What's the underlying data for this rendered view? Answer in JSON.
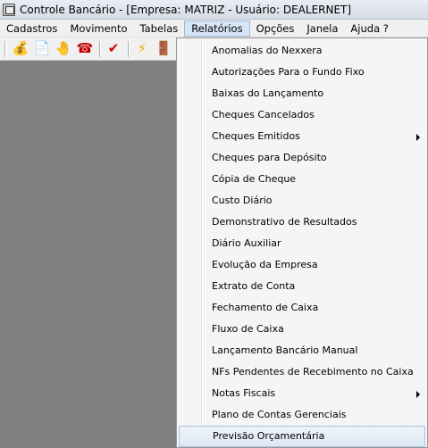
{
  "window": {
    "title": "Controle Bancário - [Empresa: MATRIZ - Usuário: DEALERNET]"
  },
  "menubar": {
    "items": [
      {
        "label": "Cadastros"
      },
      {
        "label": "Movimento"
      },
      {
        "label": "Tabelas"
      },
      {
        "label": "Relatórios"
      },
      {
        "label": "Opções"
      },
      {
        "label": "Janela"
      },
      {
        "label": "Ajuda ?"
      }
    ],
    "active": "Relatórios"
  },
  "toolbar": {
    "buttons": [
      {
        "icon": "money-bag-icon",
        "glyph": "💰"
      },
      {
        "icon": "document-icon",
        "glyph": "📄"
      },
      {
        "icon": "hand-icon",
        "glyph": "🤚"
      },
      {
        "icon": "phone-icon",
        "glyph": "☎"
      },
      {
        "icon": "checkmark-icon",
        "glyph": "✔"
      },
      {
        "icon": "lightning-icon",
        "glyph": "⚡"
      },
      {
        "icon": "exit-door-icon",
        "glyph": "🚪"
      }
    ]
  },
  "relatorios_menu": {
    "items": [
      {
        "label": "Anomalias do Nexxera",
        "submenu": false
      },
      {
        "label": "Autorizações Para o Fundo Fixo",
        "submenu": false
      },
      {
        "label": "Baixas do Lançamento",
        "submenu": false
      },
      {
        "label": "Cheques Cancelados",
        "submenu": false
      },
      {
        "label": "Cheques Emitidos",
        "submenu": true
      },
      {
        "label": "Cheques para Depósito",
        "submenu": false
      },
      {
        "label": "Cópia de Cheque",
        "submenu": false
      },
      {
        "label": "Custo Diário",
        "submenu": false
      },
      {
        "label": "Demonstrativo de Resultados",
        "submenu": false
      },
      {
        "label": "Diário Auxiliar",
        "submenu": false
      },
      {
        "label": "Evolução da Empresa",
        "submenu": false
      },
      {
        "label": "Extrato de Conta",
        "submenu": false
      },
      {
        "label": "Fechamento de Caixa",
        "submenu": false
      },
      {
        "label": "Fluxo de Caixa",
        "submenu": false
      },
      {
        "label": "Lançamento Bancário Manual",
        "submenu": false
      },
      {
        "label": "NFs Pendentes de Recebimento no Caixa",
        "submenu": false
      },
      {
        "label": "Notas Fiscais",
        "submenu": true
      },
      {
        "label": "Plano de Contas Gerenciais",
        "submenu": false
      },
      {
        "label": "Previsão Orçamentária",
        "submenu": false
      }
    ],
    "highlighted": "Previsão Orçamentária"
  },
  "colors": {
    "workspace": "#808080",
    "highlight": "#dde8f5",
    "menubar": "#f0f0f0"
  }
}
